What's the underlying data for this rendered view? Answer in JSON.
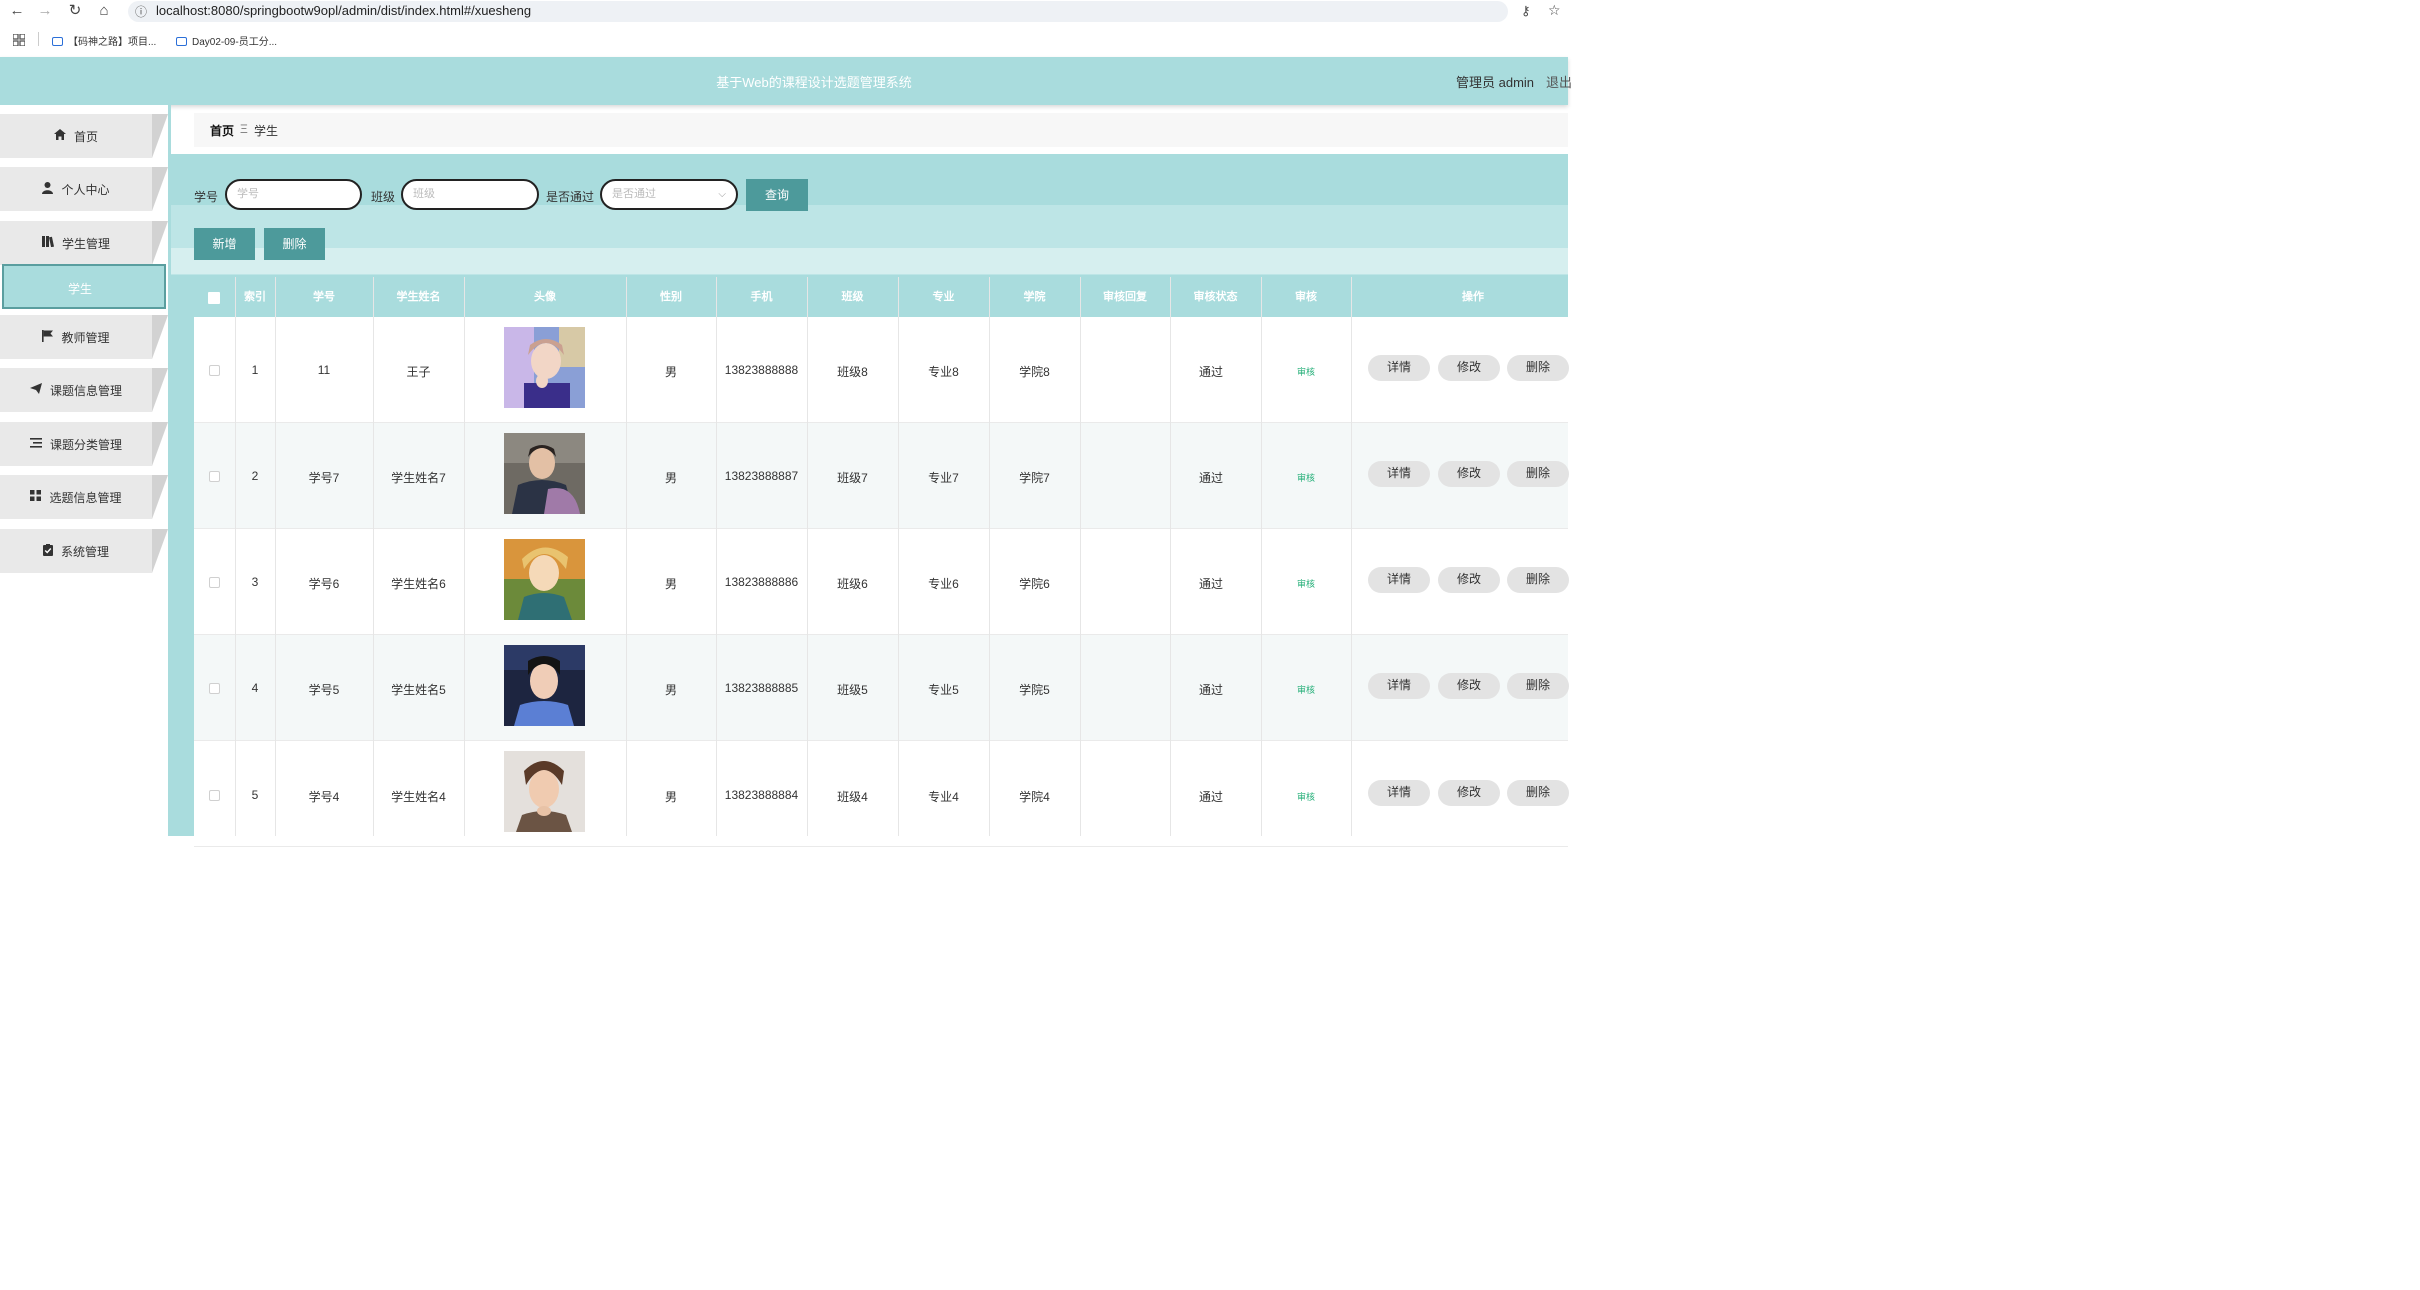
{
  "browser": {
    "url": "localhost:8080/springbootw9opl/admin/dist/index.html#/xuesheng",
    "bookmarks": [
      "【码神之路】项目...",
      "Day02-09-员工分..."
    ]
  },
  "header": {
    "title": "基于Web的课程设计选题管理系统",
    "admin": "管理员 admin",
    "logout": "退出"
  },
  "sidebar": {
    "items": [
      {
        "label": "首页",
        "icon": "home-icon"
      },
      {
        "label": "个人中心",
        "icon": "user-icon"
      },
      {
        "label": "学生管理",
        "icon": "library-icon"
      },
      {
        "label": "教师管理",
        "icon": "flag-icon"
      },
      {
        "label": "课题信息管理",
        "icon": "send-icon"
      },
      {
        "label": "课题分类管理",
        "icon": "list-icon"
      },
      {
        "label": "选题信息管理",
        "icon": "grid-icon"
      },
      {
        "label": "系统管理",
        "icon": "clipboard-check-icon"
      }
    ],
    "submenu_active": "学生"
  },
  "breadcrumb": {
    "home": "首页",
    "separator": "Ξ",
    "current": "学生"
  },
  "search": {
    "student_no_label": "学号",
    "student_no_placeholder": "学号",
    "class_label": "班级",
    "class_placeholder": "班级",
    "passed_label": "是否通过",
    "passed_placeholder": "是否通过",
    "query_button": "查询"
  },
  "actions": {
    "add": "新增",
    "delete": "删除"
  },
  "table": {
    "headers": [
      "索引",
      "学号",
      "学生姓名",
      "头像",
      "性别",
      "手机",
      "班级",
      "专业",
      "学院",
      "审核回复",
      "审核状态",
      "审核",
      "操作"
    ],
    "row_buttons": {
      "detail": "详情",
      "edit": "修改",
      "delete": "删除",
      "audit": "审核"
    },
    "rows": [
      {
        "index": "1",
        "student_no": "11",
        "name": "王子",
        "gender": "男",
        "phone": "13823888888",
        "class": "班级8",
        "major": "专业8",
        "college": "学院8",
        "reply": "",
        "status": "通过"
      },
      {
        "index": "2",
        "student_no": "学号7",
        "name": "学生姓名7",
        "gender": "男",
        "phone": "13823888887",
        "class": "班级7",
        "major": "专业7",
        "college": "学院7",
        "reply": "",
        "status": "通过"
      },
      {
        "index": "3",
        "student_no": "学号6",
        "name": "学生姓名6",
        "gender": "男",
        "phone": "13823888886",
        "class": "班级6",
        "major": "专业6",
        "college": "学院6",
        "reply": "",
        "status": "通过"
      },
      {
        "index": "4",
        "student_no": "学号5",
        "name": "学生姓名5",
        "gender": "男",
        "phone": "13823888885",
        "class": "班级5",
        "major": "专业5",
        "college": "学院5",
        "reply": "",
        "status": "通过"
      },
      {
        "index": "5",
        "student_no": "学号4",
        "name": "学生姓名4",
        "gender": "男",
        "phone": "13823888884",
        "class": "班级4",
        "major": "专业4",
        "college": "学院4",
        "reply": "",
        "status": "通过"
      }
    ]
  },
  "colors": {
    "theme": "#a9dcdd",
    "button": "#4d9a9b",
    "audit_link": "#27b07a"
  }
}
